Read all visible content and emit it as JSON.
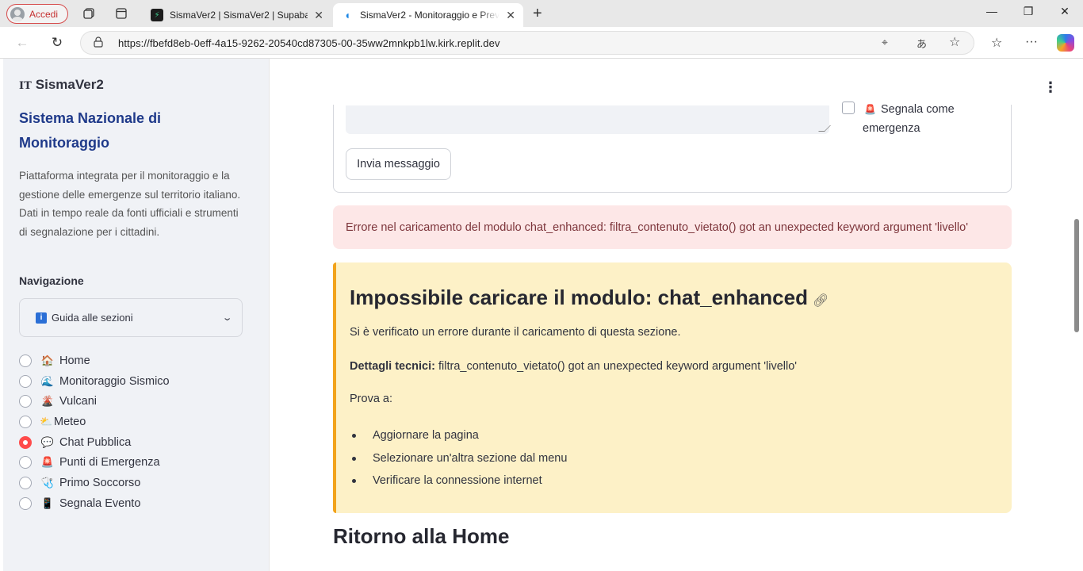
{
  "browser": {
    "profile_label": "Accedi",
    "tabs": [
      {
        "title": "SismaVer2 | SismaVer2 | Supabase",
        "active": false
      },
      {
        "title": "SismaVer2 - Monitoraggio e Prevenzione",
        "active": true
      }
    ],
    "url": "https://fbefd8eb-0eff-4a15-9262-20540cd87305-00-35ww2mnkpb1lw.kirk.replit.dev"
  },
  "sidebar": {
    "app_flag": "IT",
    "app_name": "SismaVer2",
    "system_title": "Sistema Nazionale di Monitoraggio",
    "description": "Piattaforma integrata per il monitoraggio e la gestione delle emergenze sul territorio italiano. Dati in tempo reale da fonti ufficiali e strumenti di segnalazione per i cittadini.",
    "nav_title": "Navigazione",
    "guide_label": "Guida alle sezioni",
    "items": [
      {
        "label": "Home",
        "icon": "🏠",
        "checked": false
      },
      {
        "label": "Monitoraggio Sismico",
        "icon": "🌊",
        "checked": false
      },
      {
        "label": "Vulcani",
        "icon": "🌋",
        "checked": false
      },
      {
        "label": "Meteo",
        "icon": "⛅",
        "checked": false
      },
      {
        "label": "Chat Pubblica",
        "icon": "💬",
        "checked": true
      },
      {
        "label": "Punti di Emergenza",
        "icon": "🚨",
        "checked": false
      },
      {
        "label": "Primo Soccorso",
        "icon": "🩺",
        "checked": false
      },
      {
        "label": "Segnala Evento",
        "icon": "📱",
        "checked": false
      }
    ]
  },
  "form": {
    "emergency_label": "Segnala come emergenza",
    "emergency_icon": "🚨",
    "send_label": "Invia messaggio"
  },
  "error": {
    "message": "Errore nel caricamento del modulo chat_enhanced: filtra_contenuto_vietato() got an unexpected keyword argument 'livello'"
  },
  "warning": {
    "title": "Impossibile caricare il modulo: chat_enhanced",
    "intro": "Si è verificato un errore durante il caricamento di questa sezione.",
    "details_label": "Dettagli tecnici:",
    "details_text": "filtra_contenuto_vietato() got an unexpected keyword argument 'livello'",
    "try_label": "Prova a:",
    "suggestions": [
      "Aggiornare la pagina",
      "Selezionare un'altra sezione dal menu",
      "Verificare la connessione internet"
    ]
  },
  "return_title": "Ritorno alla Home",
  "colors": {
    "accent": "#ff4b4b",
    "sidebar_bg": "#f0f2f6",
    "error_bg": "#fde7e7",
    "warning_bg": "#fdf1c7",
    "warning_border": "#f2a31b",
    "title_blue": "#1f3a8a"
  }
}
